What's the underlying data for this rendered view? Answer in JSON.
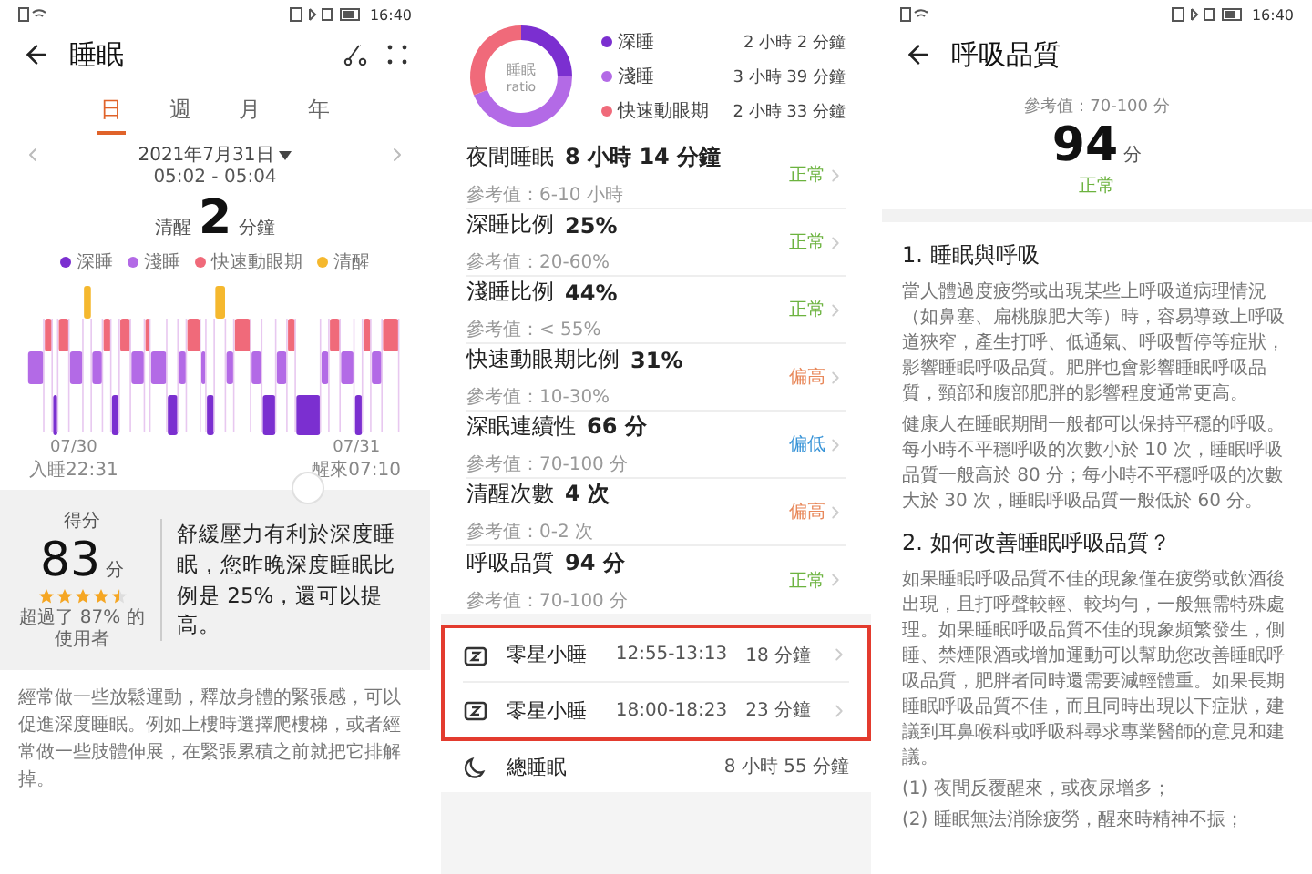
{
  "sleep_screen": {
    "status_bar": {
      "time": "16:40"
    },
    "title": "睡眠",
    "tabs": [
      {
        "label": "日",
        "selected": true
      },
      {
        "label": "週",
        "selected": false
      },
      {
        "label": "月",
        "selected": false
      },
      {
        "label": "年",
        "selected": false
      }
    ],
    "date": "2021年7月31日",
    "time_range": "05:02 - 05:04",
    "summary": {
      "label": "清醒",
      "value": "2",
      "unit": "分鐘"
    },
    "legend": [
      {
        "label": "深睡",
        "color": "#7b2fd0"
      },
      {
        "label": "淺睡",
        "color": "#b36ae6"
      },
      {
        "label": "快速動眼期",
        "color": "#f06a7a"
      },
      {
        "label": "清醒",
        "color": "#f5b82e"
      }
    ],
    "chart_start": {
      "date": "07/30",
      "label": "入睡22:31"
    },
    "chart_end": {
      "date": "07/31",
      "label": "醒來07:10"
    },
    "score": {
      "label": "得分",
      "value": "83",
      "unit": "分",
      "stars": 4.5,
      "note": "超過了 87% 的使用者"
    },
    "advice": "舒緩壓力有利於深度睡眠，您昨晚深度睡眠比例是 25%，還可以提高。",
    "tip": "經常做一些放鬆運動，釋放身體的緊張感，可以促進深度睡眠。例如上樓時選擇爬樓梯，或者經常做一些肢體伸展，在緊張累積之前就把它排解掉。"
  },
  "details_screen": {
    "donut_label": "睡眠",
    "donut_sublabel": "ratio",
    "ratio_legend": [
      {
        "label": "深睡",
        "duration": "2 小時 2 分鐘",
        "color": "#7b2fd0"
      },
      {
        "label": "淺睡",
        "duration": "3 小時 39 分鐘",
        "color": "#b36ae6"
      },
      {
        "label": "快速動眼期",
        "duration": "2 小時 33 分鐘",
        "color": "#f06a7a"
      }
    ],
    "metrics": [
      {
        "name": "夜間睡眠",
        "value": "8 小時 14 分鐘",
        "reference": "參考值：6-10 小時",
        "status": "正常",
        "color": "#6cb33f"
      },
      {
        "name": "深睡比例",
        "value": "25%",
        "reference": "參考值：20-60%",
        "status": "正常",
        "color": "#6cb33f"
      },
      {
        "name": "淺睡比例",
        "value": "44%",
        "reference": "參考值：< 55%",
        "status": "正常",
        "color": "#6cb33f"
      },
      {
        "name": "快速動眼期比例",
        "value": "31%",
        "reference": "參考值：10-30%",
        "status": "偏高",
        "color": "#e8885a"
      },
      {
        "name": "深眠連續性",
        "value": "66 分",
        "reference": "參考值：70-100 分",
        "status": "偏低",
        "color": "#3a95d8"
      },
      {
        "name": "清醒次數",
        "value": "4 次",
        "reference": "參考值：0-2 次",
        "status": "偏高",
        "color": "#e8885a"
      },
      {
        "name": "呼吸品質",
        "value": "94 分",
        "reference": "參考值：70-100 分",
        "status": "正常",
        "color": "#6cb33f"
      }
    ],
    "naps": {
      "highlighted": true,
      "items": [
        {
          "label": "零星小睡",
          "time": "12:55-13:13",
          "duration": "18 分鐘"
        },
        {
          "label": "零星小睡",
          "time": "18:00-18:23",
          "duration": "23 分鐘"
        }
      ]
    },
    "total": {
      "label": "總睡眠",
      "value": "8 小時 55 分鐘"
    }
  },
  "breathing_screen": {
    "status_bar": {
      "time": "16:40"
    },
    "title": "呼吸品質",
    "reference": "參考值：70-100 分",
    "score": "94",
    "unit": "分",
    "status": "正常",
    "sections": [
      {
        "heading": "1. 睡眠與呼吸",
        "paragraphs": [
          "當人體過度疲勞或出現某些上呼吸道病理情況（如鼻塞、扁桃腺肥大等）時，容易導致上呼吸道狹窄，產生打呼、低通氣、呼吸暫停等症狀，影響睡眠呼吸品質。肥胖也會影響睡眠呼吸品質，頸部和腹部肥胖的影響程度通常更高。",
          "健康人在睡眠期間一般都可以保持平穩的呼吸。每小時不平穩呼吸的次數小於 10 次，睡眠呼吸品質一般高於 80 分；每小時不平穩呼吸的次數大於 30 次，睡眠呼吸品質一般低於 60 分。"
        ]
      },
      {
        "heading": "2. 如何改善睡眠呼吸品質？",
        "paragraphs": [
          "如果睡眠呼吸品質不佳的現象僅在疲勞或飲酒後出現，且打呼聲較輕、較均勻，一般無需特殊處理。如果睡眠呼吸品質不佳的現象頻繁發生，側睡、禁煙限酒或增加運動可以幫助您改善睡眠呼吸品質，肥胖者同時還需要減輕體重。如果長期睡眠呼吸品質不佳，而且同時出現以下症狀，建議到耳鼻喉科或呼吸科尋求專業醫師的意見和建議。",
          "(1) 夜間反覆醒來，或夜尿增多；",
          "(2) 睡眠無法消除疲勞，醒來時精神不振；"
        ]
      }
    ]
  }
}
